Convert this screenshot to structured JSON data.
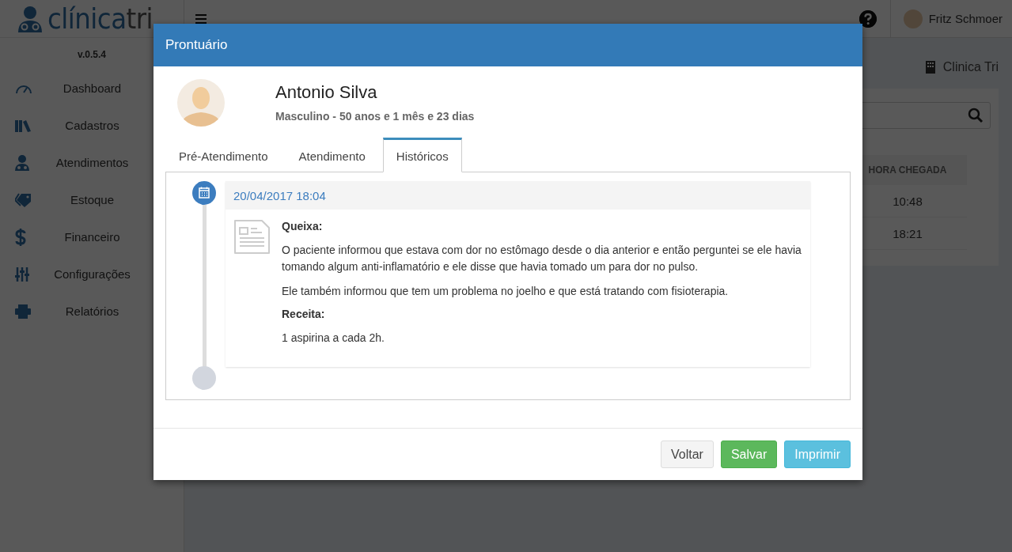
{
  "sidebar": {
    "logo": {
      "part_1": "clínica",
      "part_2": "tri"
    },
    "version": "v.0.5.4",
    "items": [
      {
        "label": "Dashboard"
      },
      {
        "label": "Cadastros"
      },
      {
        "label": "Atendimentos"
      },
      {
        "label": "Estoque"
      },
      {
        "label": "Financeiro"
      },
      {
        "label": "Configurações"
      },
      {
        "label": "Relatórios"
      }
    ]
  },
  "topbar": {
    "user_name": "Fritz Schmoer"
  },
  "main": {
    "clinic_name": "Clinica Tri",
    "table": {
      "columns": [
        "HORA CHEGADA"
      ],
      "rows": [
        [
          "10:48"
        ],
        [
          "18:21"
        ]
      ]
    }
  },
  "modal": {
    "title": "Prontuário",
    "patient": {
      "name": "Antonio Silva",
      "details": "Masculino - 50 anos e 1 mês e 23 dias"
    },
    "tabs": [
      {
        "label": "Pré-Atendimento",
        "selected": false
      },
      {
        "label": "Atendimento",
        "selected": false
      },
      {
        "label": "Históricos",
        "selected": true
      }
    ],
    "history": [
      {
        "date": "20/04/2017 18:04",
        "sections": [
          {
            "kind": "heading",
            "text": "Queixa:"
          },
          {
            "kind": "paragraph",
            "text": "O paciente informou que estava com dor no estômago desde o dia anterior e então perguntei se ele havia tomando algum anti-inflamatório e ele disse que havia tomado um para dor no pulso."
          },
          {
            "kind": "paragraph",
            "text": "Ele também informou que tem um problema no joelho e que está tratando com fisioterapia."
          },
          {
            "kind": "heading",
            "text": "Receita:"
          },
          {
            "kind": "paragraph",
            "text": "1 aspirina a cada 2h."
          }
        ]
      }
    ],
    "buttons": [
      {
        "label": "Voltar",
        "kind": "default"
      },
      {
        "label": "Salvar",
        "kind": "success"
      },
      {
        "label": "Imprimir",
        "kind": "info"
      }
    ]
  }
}
